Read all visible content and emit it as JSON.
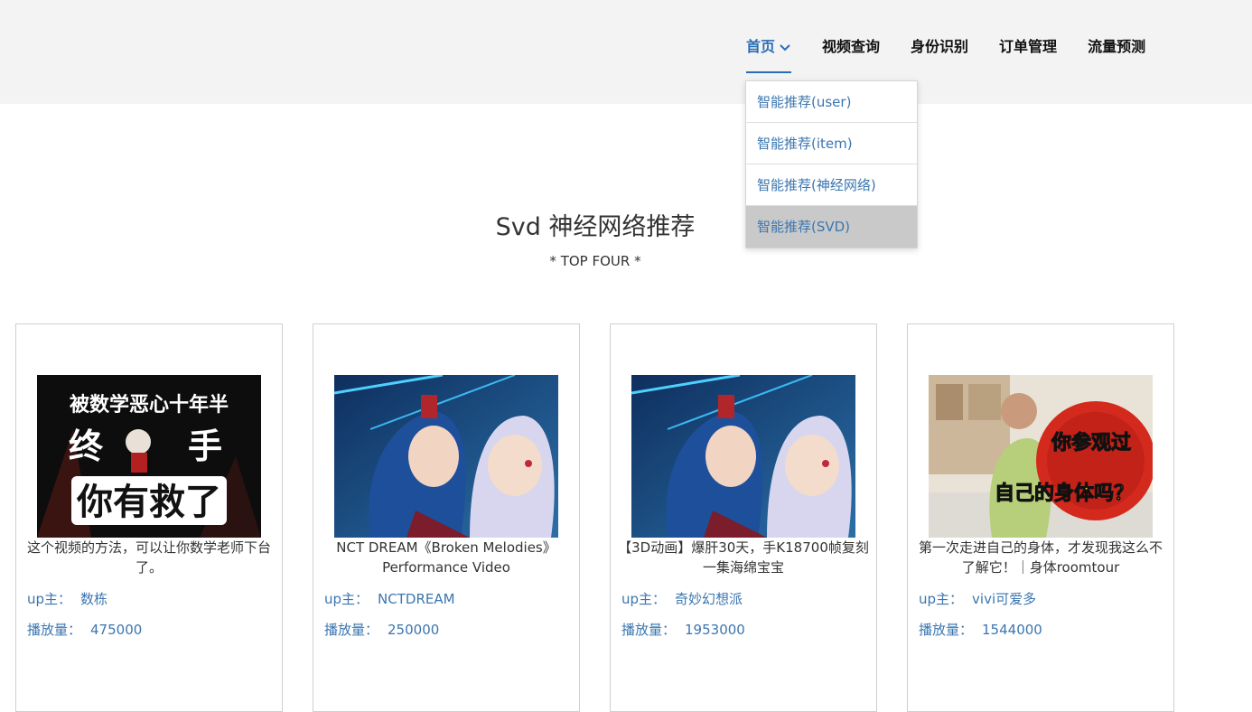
{
  "nav": {
    "items": [
      {
        "label": "首页",
        "active": true
      },
      {
        "label": "视频查询"
      },
      {
        "label": "身份识别"
      },
      {
        "label": "订单管理"
      },
      {
        "label": "流量预测"
      }
    ]
  },
  "dropdown": {
    "items": [
      {
        "label": "智能推荐(user)"
      },
      {
        "label": "智能推荐(item)"
      },
      {
        "label": "智能推荐(神经网络)"
      },
      {
        "label": "智能推荐(SVD)",
        "selected": true
      }
    ]
  },
  "section": {
    "title": "Svd 神经网络推荐",
    "subtitle": "* TOP FOUR *"
  },
  "meta_labels": {
    "up": "up主：",
    "plays": "播放量："
  },
  "cards": [
    {
      "title": "这个视频的方法，可以让你数学老师下台了。",
      "uploader": "数栋",
      "plays": "475000",
      "thumb_text": [
        "被数学恶心十年半",
        "终",
        "手",
        "你有救了"
      ]
    },
    {
      "title": "NCT DREAM《Broken Melodies》Performance Video",
      "uploader": "NCTDREAM",
      "plays": "250000"
    },
    {
      "title": "【3D动画】爆肝30天，手K18700帧复刻一集海绵宝宝",
      "uploader": "奇妙幻想派",
      "plays": "1953000"
    },
    {
      "title": "第一次走进自己的身体，才发现我这么不了解它！｜身体roomtour",
      "uploader": "vivi可爱多",
      "plays": "1544000",
      "thumb_text": [
        "你参观过",
        "自己的身体吗？"
      ]
    }
  ],
  "colors": {
    "accent": "#2a6db5",
    "link": "#3b76b0",
    "topbar": "#f3f3f3",
    "selected_bg": "#c9c9c9"
  }
}
